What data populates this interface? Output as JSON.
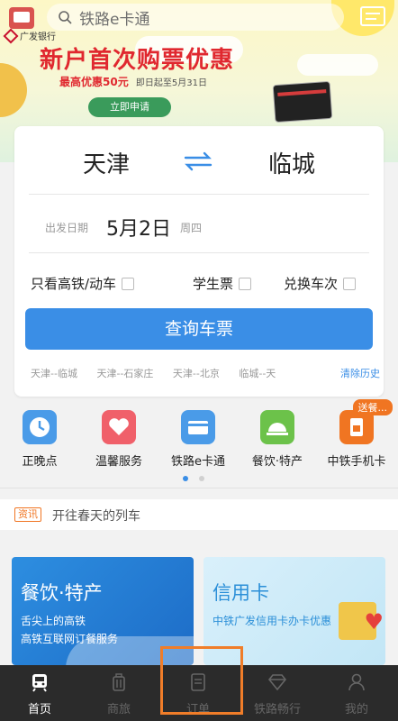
{
  "search": {
    "placeholder": "铁路e卡通"
  },
  "banner": {
    "bank_name": "广发银行",
    "title": "新户首次购票优惠",
    "subtitle": "最高优惠50元",
    "period": "即日起至5月31日",
    "apply_label": "立即申请"
  },
  "ticket": {
    "from_city": "天津",
    "to_city": "临城",
    "date_label": "出发日期",
    "date_value": "5月2日",
    "weekday": "周四",
    "options": [
      "只看高铁/动车",
      "学生票",
      "兑换车次"
    ],
    "query_label": "查询车票",
    "history": [
      "天津--临城",
      "天津--石家庄",
      "天津--北京",
      "临城--天"
    ],
    "clear_history": "清除历史"
  },
  "services": {
    "items": [
      {
        "label": "正晚点",
        "icon": "clock-icon",
        "color": "#4a9be8"
      },
      {
        "label": "温馨服务",
        "icon": "heart-icon",
        "color": "#f0606a"
      },
      {
        "label": "铁路e卡通",
        "icon": "card-icon",
        "color": "#4a9be8"
      },
      {
        "label": "餐饮·特产",
        "icon": "dish-icon",
        "color": "#6cc24a"
      },
      {
        "label": "中铁手机卡",
        "icon": "sim-card-icon",
        "color": "#f07522"
      }
    ],
    "badge": "送餐..."
  },
  "news": {
    "tag": "资讯",
    "text": "开往春天的列车"
  },
  "promos": {
    "left": {
      "title": "餐饮·特产",
      "line1": "舌尖上的高铁",
      "line2": "高铁互联网订餐服务"
    },
    "right": {
      "title": "信用卡",
      "line1": "中铁广发信用卡办卡优惠"
    }
  },
  "tabbar": {
    "items": [
      {
        "label": "首页",
        "icon": "train-icon"
      },
      {
        "label": "商旅",
        "icon": "luggage-icon"
      },
      {
        "label": "订单",
        "icon": "order-icon"
      },
      {
        "label": "铁路畅行",
        "icon": "diamond-icon"
      },
      {
        "label": "我的",
        "icon": "user-icon"
      }
    ]
  },
  "colors": {
    "accent": "#3a8ee6",
    "highlight": "#f07d29",
    "banner_red": "#e0282f"
  }
}
